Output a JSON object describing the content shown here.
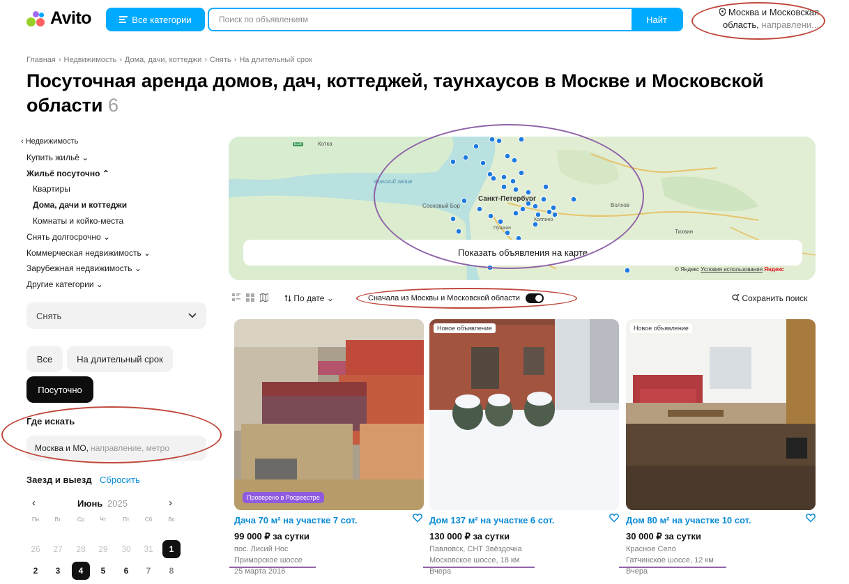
{
  "header": {
    "logo_text": "Avito",
    "categories_label": "Все категории",
    "search_placeholder": "Поиск по объявлениям",
    "search_button": "Найт",
    "location_main": "Москва и Московская",
    "location_line2": "область,",
    "location_muted": "направлени..."
  },
  "breadcrumbs": [
    "Главная",
    "Недвижимость",
    "Дома, дачи, коттеджи",
    "Снять",
    "На длительный срок"
  ],
  "title": {
    "text": "Посуточная аренда домов, дач, коттеджей, таунхаусов в Москве и Московской области",
    "count": "6"
  },
  "sidebar": {
    "nav": [
      {
        "label": "‹ Недвижимость"
      },
      {
        "label": "Купить жильё ⌄"
      },
      {
        "label": "Жильё посуточно ⌃"
      },
      {
        "label": "Квартиры"
      },
      {
        "label": "Дома, дачи и коттеджи"
      },
      {
        "label": "Комнаты и койко-места"
      },
      {
        "label": "Снять долгосрочно ⌄"
      },
      {
        "label": "Коммерческая недвижимость ⌄"
      },
      {
        "label": "Зарубежная недвижимость ⌄"
      },
      {
        "label": "Другие категории ⌄"
      }
    ],
    "deal_select": "Снять",
    "term_all": "Все",
    "term_long": "На длительный срок",
    "term_daily": "Посуточно",
    "where_title": "Где искать",
    "where_value": "Москва и МО,",
    "where_placeholder": "направление, метро",
    "dates_title": "Заезд и выезд",
    "dates_reset": "Сбросить",
    "calendar": {
      "month": "Июнь",
      "year": "2025",
      "weekdays": [
        "Пн",
        "Вт",
        "Ср",
        "Чт",
        "Пт",
        "Сб",
        "Вс"
      ],
      "row1": [
        "26",
        "27",
        "28",
        "29",
        "30",
        "31",
        "1"
      ],
      "row2": [
        "2",
        "3",
        "4",
        "5",
        "6",
        "7",
        "8"
      ]
    }
  },
  "map": {
    "button": "Показать объявления на карте",
    "city_label": "Санкт-Петербург",
    "labels": [
      "Котка",
      "Финский залив",
      "Сосновый Бор",
      "Колпино",
      "Пушкин",
      "Волхов",
      "Тихвин",
      "E18"
    ],
    "credit": "© Яндекс",
    "terms": "Условия использования",
    "brand": "Яндекс"
  },
  "toolbar": {
    "sort": "По дате ⌄",
    "moscow_first": "Сначала из Москвы и Московской области",
    "save_search": "Сохранить поиск"
  },
  "listings": [
    {
      "badge": "Проверено в Росреестре",
      "title": "Дача 70 м² на участке 7 сот.",
      "price": "99 000 ₽ за сутки",
      "address": "пос. Лисий Нос",
      "road": "Приморское шоссе",
      "date": "25 марта 2016"
    },
    {
      "badge": "Новое объявление",
      "title": "Дом 137 м² на участке 6 сот.",
      "price": "130 000 ₽ за сутки",
      "address": "Павловск, СНТ Звёздочка",
      "road": "Московское шоссе, 18 км",
      "date": "Вчера"
    },
    {
      "badge": "Новое объявление",
      "title": "Дом 80 м² на участке 10 сот.",
      "price": "30 000 ₽ за сутки",
      "address": "Красное Село",
      "road": "Гатчинское шоссе, 12 км",
      "date": "Вчера"
    }
  ],
  "colors": {
    "accent": "#00aaff",
    "link": "#0a8bd6",
    "annotation_red": "#c0483c",
    "annotation_purple": "#8f64a8"
  }
}
